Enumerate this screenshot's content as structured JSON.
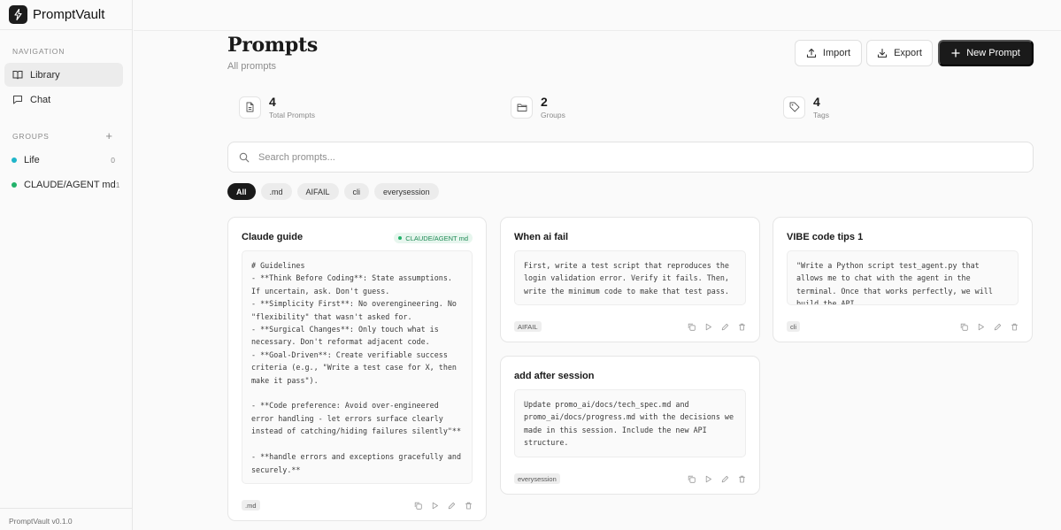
{
  "app": {
    "name": "PromptVault",
    "version": "PromptVault v0.1.0"
  },
  "sidebar": {
    "navigation_label": "NAVIGATION",
    "nav": [
      {
        "label": "Library",
        "icon": "book-icon",
        "active": true
      },
      {
        "label": "Chat",
        "icon": "chat-icon",
        "active": false
      }
    ],
    "groups_label": "GROUPS",
    "add_group": "+",
    "groups": [
      {
        "name": "Life",
        "count": "0",
        "color": "#1fb5c9"
      },
      {
        "name": "CLAUDE/AGENT md",
        "count": "1",
        "color": "#22b26a"
      }
    ]
  },
  "header": {
    "title": "Prompts",
    "subtitle": "All prompts",
    "import_label": "Import",
    "export_label": "Export",
    "new_label": "New Prompt"
  },
  "stats": [
    {
      "value": "4",
      "label": "Total Prompts",
      "icon": "document-icon"
    },
    {
      "value": "2",
      "label": "Groups",
      "icon": "folder-icon"
    },
    {
      "value": "4",
      "label": "Tags",
      "icon": "tag-icon"
    }
  ],
  "search": {
    "placeholder": "Search prompts..."
  },
  "filters": [
    {
      "label": "All",
      "active": true
    },
    {
      "label": ".md",
      "active": false
    },
    {
      "label": "AIFAIL",
      "active": false
    },
    {
      "label": "cli",
      "active": false
    },
    {
      "label": "everysession",
      "active": false
    }
  ],
  "cards": [
    {
      "title": "Claude guide",
      "badge": "CLAUDE/AGENT md",
      "body": "# Guidelines\n- **Think Before Coding**: State assumptions. If uncertain, ask. Don't guess.\n- **Simplicity First**: No overengineering. No \"flexibility\" that wasn't asked for.\n- **Surgical Changes**: Only touch what is necessary. Don't reformat adjacent code.\n- **Goal-Driven**: Create verifiable success criteria (e.g., \"Write a test case for X, then make it pass\").\n\n- **Code preference: Avoid over-engineered error handling - let errors surface clearly instead of catching/hiding failures silently\"**\n\n- **handle errors and exceptions gracefully and securely.**",
      "tag": ".md"
    },
    {
      "title": "When ai fail",
      "badge": "",
      "body": "First, write a test script that reproduces the login validation error. Verify it fails. Then, write the minimum code to make that test pass.",
      "tag": "AIFAIL"
    },
    {
      "title": "VIBE code tips 1",
      "badge": "",
      "body": "\"Write a Python script test_agent.py that allows me to chat with the agent in the terminal. Once that works perfectly, we will build the API",
      "tag": "cli"
    },
    {
      "title": "add after session",
      "badge": "",
      "body": "Update promo_ai/docs/tech_spec.md and promo_ai/docs/progress.md with the decisions we made in this session. Include the new API structure.",
      "tag": "everysession"
    }
  ]
}
